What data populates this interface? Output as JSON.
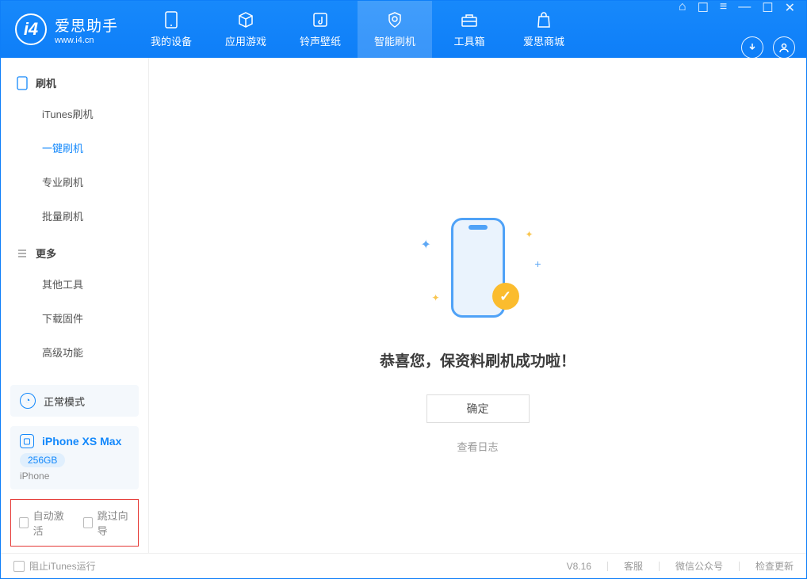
{
  "app": {
    "title": "爱思助手",
    "subtitle": "www.i4.cn"
  },
  "nav": {
    "items": [
      {
        "label": "我的设备"
      },
      {
        "label": "应用游戏"
      },
      {
        "label": "铃声壁纸"
      },
      {
        "label": "智能刷机"
      },
      {
        "label": "工具箱"
      },
      {
        "label": "爱思商城"
      }
    ]
  },
  "sidebar": {
    "section1": {
      "title": "刷机"
    },
    "items1": [
      {
        "label": "iTunes刷机"
      },
      {
        "label": "一键刷机"
      },
      {
        "label": "专业刷机"
      },
      {
        "label": "批量刷机"
      }
    ],
    "section2": {
      "title": "更多"
    },
    "items2": [
      {
        "label": "其他工具"
      },
      {
        "label": "下载固件"
      },
      {
        "label": "高级功能"
      }
    ]
  },
  "mode": {
    "label": "正常模式"
  },
  "device": {
    "name": "iPhone XS Max",
    "storage": "256GB",
    "type": "iPhone"
  },
  "options": {
    "auto_activate": "自动激活",
    "skip_guide": "跳过向导"
  },
  "main": {
    "success_message": "恭喜您，保资料刷机成功啦！",
    "ok_button": "确定",
    "view_log": "查看日志"
  },
  "footer": {
    "block_itunes": "阻止iTunes运行",
    "version": "V8.16",
    "support": "客服",
    "wechat": "微信公众号",
    "check_update": "检查更新"
  }
}
